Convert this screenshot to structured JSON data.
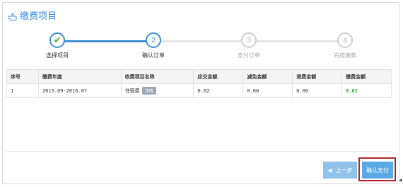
{
  "header": {
    "title": "缴费项目"
  },
  "stepper": {
    "steps": [
      {
        "number": "1",
        "label": "选择项目",
        "state": "done"
      },
      {
        "number": "2",
        "label": "确认订单",
        "state": "active"
      },
      {
        "number": "3",
        "label": "支付订单",
        "state": "pending"
      },
      {
        "number": "4",
        "label": "完成缴款",
        "state": "pending"
      }
    ]
  },
  "table": {
    "columns": [
      "序号",
      "缴费年度",
      "收费项目名称",
      "应交金额",
      "减免金额",
      "退费金额",
      "缴费金额"
    ],
    "rows": [
      {
        "index": "1",
        "year": "2015.09-2016.07",
        "item": "住宿费",
        "tag": "详情",
        "due": "0.02",
        "reduced": "0.00",
        "refund": "0.00",
        "pay": "0.02"
      }
    ]
  },
  "buttons": {
    "prev": "上一步",
    "confirm": "确认支付"
  },
  "colors": {
    "accent": "#3f8fd2",
    "highlight": "#b5252a",
    "paid": "#3fa63f"
  }
}
